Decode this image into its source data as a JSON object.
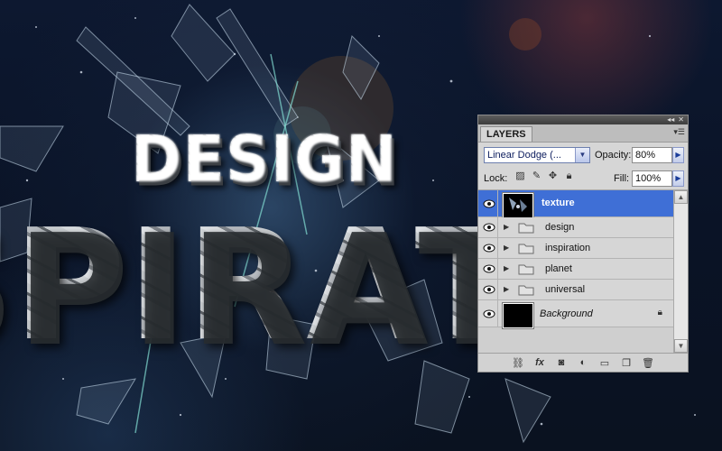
{
  "artwork": {
    "word_top": "DESIGN",
    "word_main": "SPIRAT"
  },
  "panel": {
    "tab_label": "LAYERS",
    "blend_mode": "Linear Dodge (...",
    "opacity_label": "Opacity:",
    "opacity_value": "80%",
    "lock_label": "Lock:",
    "fill_label": "Fill:",
    "fill_value": "100%",
    "layers": [
      {
        "name": "texture",
        "type": "layer",
        "selected": true
      },
      {
        "name": "design",
        "type": "group"
      },
      {
        "name": "inspiration",
        "type": "group"
      },
      {
        "name": "planet",
        "type": "group"
      },
      {
        "name": "universal",
        "type": "group"
      },
      {
        "name": "Background",
        "type": "background",
        "locked": true
      }
    ],
    "icons": {
      "lock": [
        "lock-transparent-pixels-icon",
        "lock-image-pixels-icon",
        "lock-position-icon",
        "lock-all-icon"
      ],
      "footer": [
        "link-layers-icon",
        "fx-icon",
        "add-mask-icon",
        "adjustment-layer-icon",
        "new-group-icon",
        "new-layer-icon",
        "trash-icon"
      ]
    },
    "colors": {
      "selection": "#3f6fd6",
      "panel_bg": "#d6d6d6"
    }
  }
}
